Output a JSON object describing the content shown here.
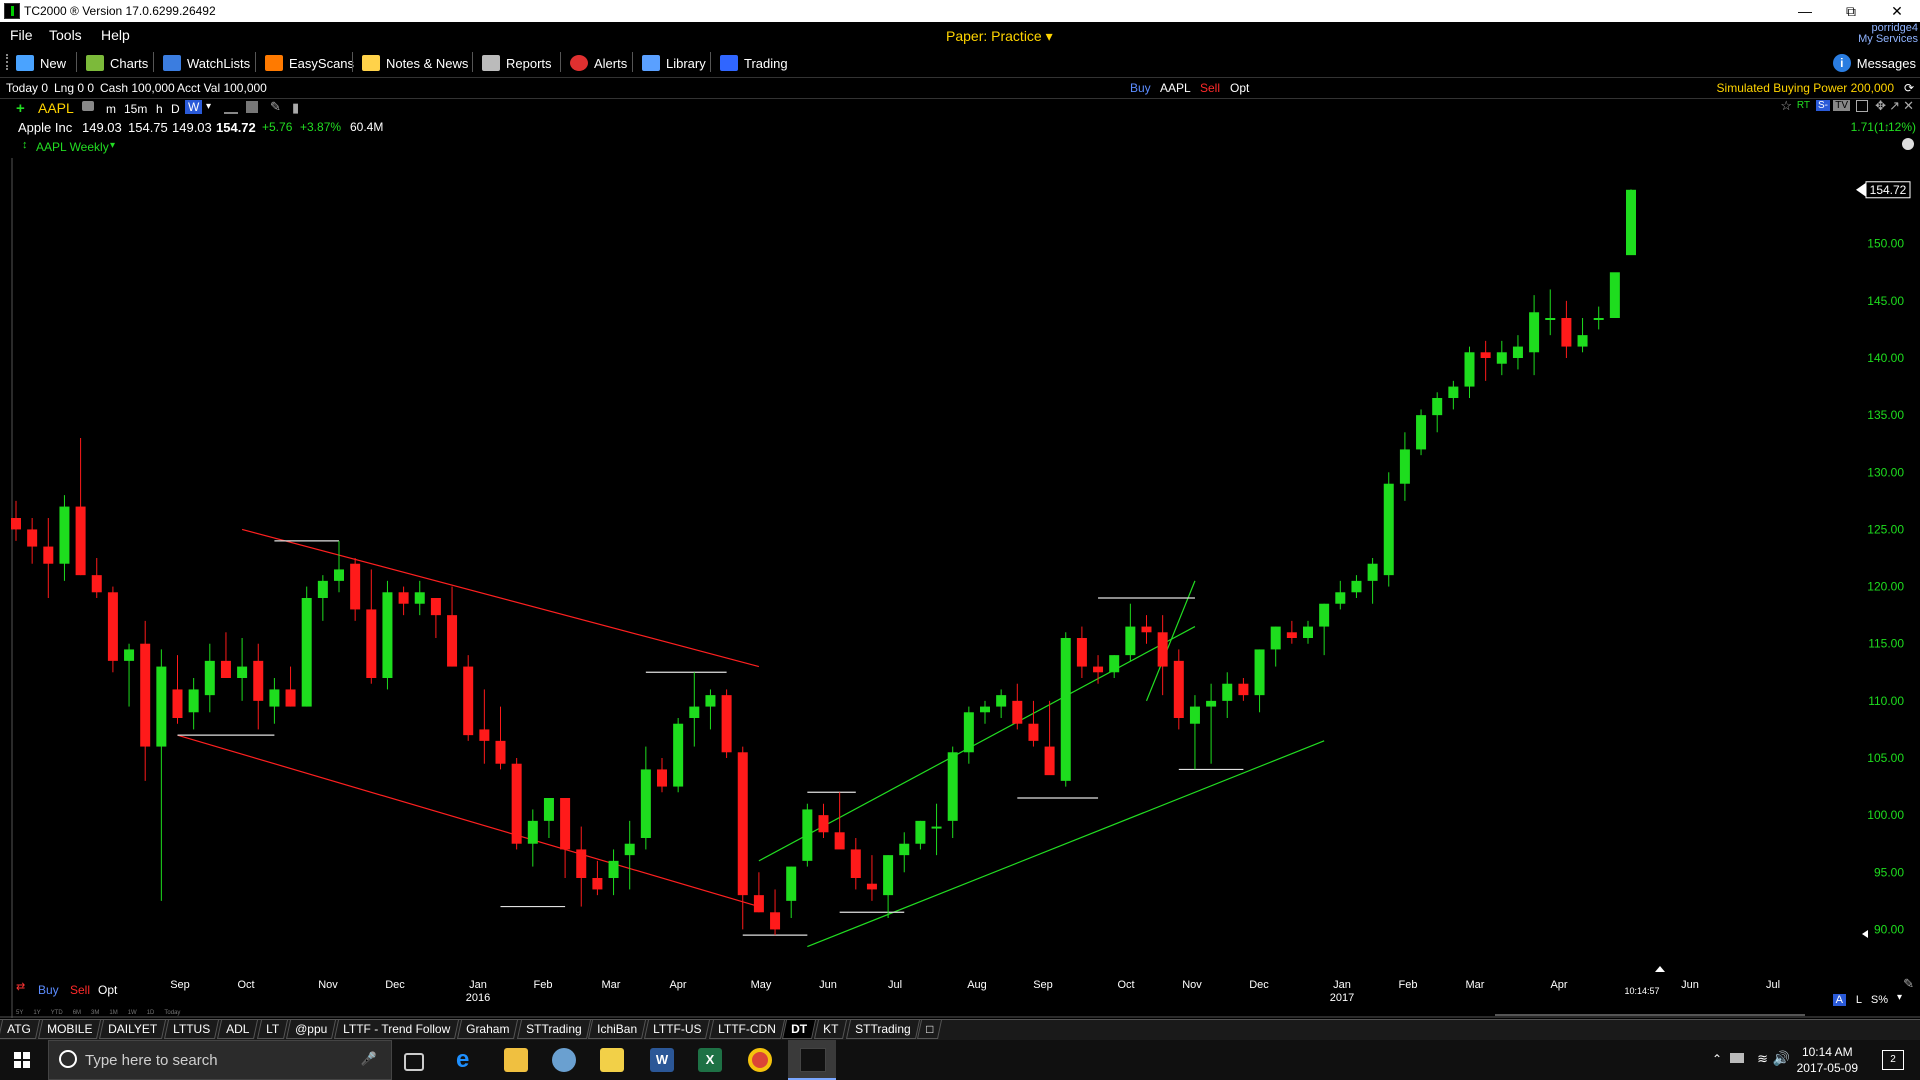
{
  "window": {
    "title": "TC2000 ® Version 17.0.6299.26492",
    "controls": [
      "minimize-icon",
      "restore-icon",
      "close-icon"
    ]
  },
  "menu": {
    "items": [
      "File",
      "Tools",
      "Help"
    ],
    "account_mode": "Paper: Practice",
    "services_line1": "porridge4",
    "services_line2": "My Services"
  },
  "toolbar": {
    "items": [
      {
        "label": "New",
        "icon": "new-window-icon",
        "color": "#4aa3ff"
      },
      {
        "label": "Charts",
        "icon": "charts-icon",
        "color": "#7cba3a"
      },
      {
        "label": "WatchLists",
        "icon": "watchlist-icon",
        "color": "#3b7de0"
      },
      {
        "label": "EasyScans",
        "icon": "easyscans-icon",
        "color": "#ff7a00"
      },
      {
        "label": "Notes & News",
        "icon": "notes-icon",
        "color": "#ffd24a"
      },
      {
        "label": "Reports",
        "icon": "reports-icon",
        "color": "#bbbbbb"
      },
      {
        "label": "Alerts",
        "icon": "alerts-icon",
        "color": "#e03030"
      },
      {
        "label": "Library",
        "icon": "library-icon",
        "color": "#5aa0ff"
      },
      {
        "label": "Trading",
        "icon": "trading-icon",
        "color": "#3066ff"
      }
    ],
    "messages": "Messages"
  },
  "account": {
    "today": "Today 0",
    "lng": "Lng 0 0",
    "cash": "Cash 100,000",
    "acct_val": "Acct Val 100,000",
    "buy": "Buy",
    "symbol": "AAPL",
    "sell": "Sell",
    "opt": "Opt",
    "buying_power": "Simulated Buying Power 200,000"
  },
  "chart_header": {
    "symbol": "AAPL",
    "intervals": [
      "m",
      "15m",
      "h",
      "D",
      "W"
    ],
    "active_interval": "W",
    "company": "Apple Inc",
    "open": "149.03",
    "high": "154.75",
    "low": "149.03",
    "close": "154.72",
    "change": "+5.76",
    "change_pct": "+3.87%",
    "volume": "60.4M",
    "chart_name": "AAPL Weekly",
    "right_change": "1.71(1.12%)",
    "right_badges": [
      "RT",
      "S-",
      "TV"
    ]
  },
  "chart_data": {
    "type": "candlestick",
    "title": "AAPL Weekly",
    "price_label": "154.72",
    "ylim": [
      87.5,
      157.5
    ],
    "yticks": [
      "90.00",
      "95.00",
      "100.00",
      "105.00",
      "110.00",
      "115.00",
      "120.00",
      "125.00",
      "130.00",
      "135.00",
      "140.00",
      "145.00",
      "150.00"
    ],
    "xticks": [
      {
        "label": "Sep",
        "sub": ""
      },
      {
        "label": "Oct",
        "sub": ""
      },
      {
        "label": "Nov",
        "sub": ""
      },
      {
        "label": "Dec",
        "sub": ""
      },
      {
        "label": "Jan",
        "sub": "2016"
      },
      {
        "label": "Feb",
        "sub": ""
      },
      {
        "label": "Mar",
        "sub": ""
      },
      {
        "label": "Apr",
        "sub": ""
      },
      {
        "label": "May",
        "sub": ""
      },
      {
        "label": "Jun",
        "sub": ""
      },
      {
        "label": "Jul",
        "sub": ""
      },
      {
        "label": "Aug",
        "sub": ""
      },
      {
        "label": "Sep",
        "sub": ""
      },
      {
        "label": "Oct",
        "sub": ""
      },
      {
        "label": "Nov",
        "sub": ""
      },
      {
        "label": "Dec",
        "sub": ""
      },
      {
        "label": "Jan",
        "sub": "2017"
      },
      {
        "label": "Feb",
        "sub": ""
      },
      {
        "label": "Mar",
        "sub": ""
      },
      {
        "label": "Apr",
        "sub": ""
      },
      {
        "label": "Jun",
        "sub": ""
      },
      {
        "label": "Jul",
        "sub": ""
      }
    ],
    "time_label": "10:14:57",
    "candles": [
      [
        126.0,
        127.5,
        124.0,
        125.0
      ],
      [
        125.0,
        126.0,
        122.0,
        123.5
      ],
      [
        123.5,
        126.0,
        119.0,
        122.0
      ],
      [
        122.0,
        128.0,
        120.5,
        127.0
      ],
      [
        127.0,
        133.0,
        121.0,
        121.0
      ],
      [
        121.0,
        122.5,
        119.0,
        119.5
      ],
      [
        119.5,
        120.0,
        112.5,
        113.5
      ],
      [
        113.5,
        115.0,
        109.5,
        114.5
      ],
      [
        115.0,
        117.0,
        103.0,
        106.0
      ],
      [
        106.0,
        114.5,
        92.5,
        113.0
      ],
      [
        111.0,
        114.0,
        108.0,
        108.5
      ],
      [
        109.0,
        112.0,
        107.5,
        111.0
      ],
      [
        110.5,
        115.0,
        109.0,
        113.5
      ],
      [
        113.5,
        116.0,
        112.0,
        112.0
      ],
      [
        112.0,
        115.5,
        110.0,
        113.0
      ],
      [
        113.5,
        115.0,
        107.5,
        110.0
      ],
      [
        109.5,
        112.0,
        108.0,
        111.0
      ],
      [
        111.0,
        113.0,
        109.5,
        109.5
      ],
      [
        109.5,
        120.0,
        109.5,
        119.0
      ],
      [
        119.0,
        121.0,
        117.0,
        120.5
      ],
      [
        120.5,
        124.0,
        119.5,
        121.5
      ],
      [
        122.0,
        122.5,
        117.0,
        118.0
      ],
      [
        118.0,
        121.5,
        111.5,
        112.0
      ],
      [
        112.0,
        120.5,
        111.0,
        119.5
      ],
      [
        119.5,
        120.0,
        117.5,
        118.5
      ],
      [
        118.5,
        120.5,
        117.5,
        119.5
      ],
      [
        119.0,
        118.5,
        115.5,
        117.5
      ],
      [
        117.5,
        120.0,
        113.0,
        113.0
      ],
      [
        113.0,
        114.0,
        106.5,
        107.0
      ],
      [
        107.5,
        111.0,
        104.5,
        106.5
      ],
      [
        106.5,
        109.5,
        104.0,
        104.5
      ],
      [
        104.5,
        105.0,
        97.0,
        97.5
      ],
      [
        97.5,
        100.5,
        95.5,
        99.5
      ],
      [
        99.5,
        101.5,
        98.0,
        101.5
      ],
      [
        101.5,
        101.5,
        94.5,
        97.0
      ],
      [
        97.0,
        99.0,
        92.0,
        94.5
      ],
      [
        94.5,
        96.0,
        93.0,
        93.5
      ],
      [
        94.5,
        97.0,
        93.0,
        96.0
      ],
      [
        96.5,
        99.5,
        93.5,
        97.5
      ],
      [
        98.0,
        106.0,
        97.0,
        104.0
      ],
      [
        104.0,
        105.0,
        102.0,
        102.5
      ],
      [
        102.5,
        108.5,
        102.0,
        108.0
      ],
      [
        108.5,
        112.5,
        106.0,
        109.5
      ],
      [
        109.5,
        111.0,
        107.5,
        110.5
      ],
      [
        110.5,
        111.0,
        105.0,
        105.5
      ],
      [
        105.5,
        106.0,
        90.0,
        93.0
      ],
      [
        93.0,
        95.0,
        91.5,
        91.5
      ],
      [
        91.5,
        93.5,
        89.5,
        90.0
      ],
      [
        92.5,
        95.5,
        91.0,
        95.5
      ],
      [
        96.0,
        101.0,
        95.5,
        100.5
      ],
      [
        100.0,
        101.0,
        98.0,
        98.5
      ],
      [
        98.5,
        102.0,
        97.5,
        97.0
      ],
      [
        97.0,
        98.0,
        93.5,
        94.5
      ],
      [
        94.0,
        96.5,
        92.5,
        93.5
      ],
      [
        93.0,
        96.5,
        91.0,
        96.5
      ],
      [
        96.5,
        98.5,
        95.0,
        97.5
      ],
      [
        97.5,
        99.5,
        97.0,
        99.5
      ],
      [
        99.0,
        101.0,
        96.5,
        99.0
      ],
      [
        99.5,
        106.0,
        98.0,
        105.5
      ],
      [
        105.5,
        109.5,
        104.5,
        109.0
      ],
      [
        109.0,
        110.0,
        108.0,
        109.5
      ],
      [
        109.5,
        111.0,
        108.5,
        110.5
      ],
      [
        110.0,
        111.5,
        107.5,
        108.0
      ],
      [
        108.0,
        110.0,
        106.0,
        106.5
      ],
      [
        106.0,
        110.0,
        104.5,
        103.5
      ],
      [
        103.0,
        116.0,
        102.5,
        115.5
      ],
      [
        115.5,
        116.5,
        112.0,
        113.0
      ],
      [
        113.0,
        114.0,
        111.5,
        112.5
      ],
      [
        112.5,
        114.0,
        112.0,
        114.0
      ],
      [
        114.0,
        118.5,
        113.5,
        116.5
      ],
      [
        116.5,
        117.5,
        115.0,
        116.0
      ],
      [
        116.0,
        117.5,
        110.5,
        113.0
      ],
      [
        113.5,
        114.5,
        107.5,
        108.5
      ],
      [
        108.0,
        110.5,
        104.0,
        109.5
      ],
      [
        109.5,
        111.5,
        104.5,
        110.0
      ],
      [
        110.0,
        112.5,
        108.5,
        111.5
      ],
      [
        111.5,
        112.0,
        110.0,
        110.5
      ],
      [
        110.5,
        114.5,
        109.0,
        114.5
      ],
      [
        114.5,
        116.5,
        113.0,
        116.5
      ],
      [
        116.0,
        117.0,
        115.0,
        115.5
      ],
      [
        115.5,
        117.0,
        115.0,
        116.5
      ],
      [
        116.5,
        118.5,
        114.0,
        118.5
      ],
      [
        118.5,
        120.5,
        118.0,
        119.5
      ],
      [
        119.5,
        121.0,
        119.0,
        120.5
      ],
      [
        120.5,
        122.5,
        118.5,
        122.0
      ],
      [
        121.0,
        130.0,
        120.0,
        129.0
      ],
      [
        129.0,
        133.5,
        127.5,
        132.0
      ],
      [
        132.0,
        135.5,
        131.5,
        135.0
      ],
      [
        135.0,
        137.0,
        133.5,
        136.5
      ],
      [
        136.5,
        138.0,
        135.5,
        137.5
      ],
      [
        137.5,
        141.0,
        136.5,
        140.5
      ],
      [
        140.5,
        141.5,
        138.0,
        140.0
      ],
      [
        139.5,
        141.5,
        138.5,
        140.5
      ],
      [
        140.0,
        142.0,
        139.0,
        141.0
      ],
      [
        140.5,
        145.5,
        138.5,
        144.0
      ],
      [
        143.5,
        146.0,
        142.0,
        143.5
      ],
      [
        143.5,
        145.0,
        140.0,
        141.0
      ],
      [
        141.0,
        143.5,
        140.5,
        142.0
      ],
      [
        143.5,
        144.5,
        142.5,
        143.5
      ],
      [
        143.5,
        147.0,
        143.5,
        147.5
      ],
      [
        149.0,
        154.75,
        149.03,
        154.72
      ]
    ],
    "trendlines": [
      {
        "color": "#ff2020",
        "from": [
          "c10",
          107.0
        ],
        "to": [
          "c46",
          92.0
        ]
      },
      {
        "color": "#ff2020",
        "from": [
          "c14",
          125.0
        ],
        "to": [
          "c46",
          113.0
        ]
      },
      {
        "color": "#22dd22",
        "from": [
          "c46",
          96.0
        ],
        "to": [
          "c73",
          116.5
        ]
      },
      {
        "color": "#22dd22",
        "from": [
          "c49",
          88.5
        ],
        "to": [
          "c81",
          106.5
        ]
      },
      {
        "color": "#22dd22",
        "from": [
          "c70",
          110.0
        ],
        "to": [
          "c73",
          120.5
        ]
      }
    ],
    "levels": [
      {
        "from": "c10",
        "to": "c16",
        "y": 107.0
      },
      {
        "from": "c16",
        "to": "c20",
        "y": 124.0
      },
      {
        "from": "c30",
        "to": "c34",
        "y": 92.0
      },
      {
        "from": "c39",
        "to": "c44",
        "y": 112.5
      },
      {
        "from": "c45",
        "to": "c49",
        "y": 89.5
      },
      {
        "from": "c49",
        "to": "c52",
        "y": 102.0
      },
      {
        "from": "c51",
        "to": "c55",
        "y": 91.5
      },
      {
        "from": "c62",
        "to": "c67",
        "y": 101.5
      },
      {
        "from": "c67",
        "to": "c73",
        "y": 119.0
      },
      {
        "from": "c72",
        "to": "c76",
        "y": 104.0
      }
    ]
  },
  "chart_footer": {
    "buy": "Buy",
    "sell": "Sell",
    "opt": "Opt",
    "periods": [
      "5Y",
      "1Y",
      "YTD",
      "6M",
      "3M",
      "1M",
      "1W",
      "1D",
      "Today"
    ],
    "right": [
      "A",
      "L",
      "S%"
    ]
  },
  "tabs": [
    "ATG",
    "MOBILE",
    "DAILYET",
    "LTTUS",
    "ADL",
    "LT",
    "@ppu",
    "LTTF - Trend Follow",
    "Graham",
    "STTrading",
    "IchiBan",
    "LTTF-US",
    "LTTF-CDN",
    "DT",
    "KT",
    "STTrading"
  ],
  "active_tab": "DT",
  "taskbar": {
    "search_placeholder": "Type here to search",
    "time": "10:14 AM",
    "date": "2017-05-09",
    "notifications": "2"
  }
}
